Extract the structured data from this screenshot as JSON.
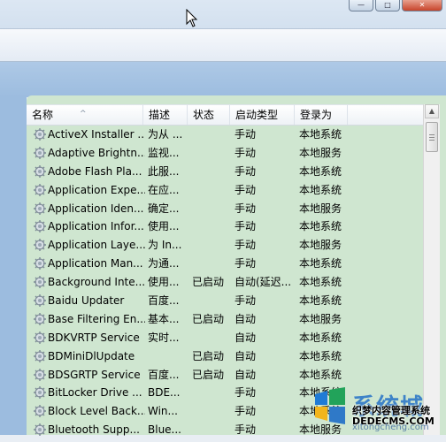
{
  "window": {
    "minimize_glyph": "—",
    "maximize_glyph": "□",
    "close_glyph": "✕"
  },
  "columns": {
    "name": "名称",
    "desc": "描述",
    "status": "状态",
    "startup": "启动类型",
    "logon": "登录为"
  },
  "rows": [
    {
      "name": "ActiveX Installer ...",
      "desc": "为从 ...",
      "status": "",
      "startup": "手动",
      "logon": "本地系统"
    },
    {
      "name": "Adaptive Brightn...",
      "desc": "监视...",
      "status": "",
      "startup": "手动",
      "logon": "本地服务"
    },
    {
      "name": "Adobe Flash Pla...",
      "desc": "此服...",
      "status": "",
      "startup": "手动",
      "logon": "本地系统"
    },
    {
      "name": "Application Expe...",
      "desc": "在应...",
      "status": "",
      "startup": "手动",
      "logon": "本地系统"
    },
    {
      "name": "Application Iden...",
      "desc": "确定...",
      "status": "",
      "startup": "手动",
      "logon": "本地服务"
    },
    {
      "name": "Application Infor...",
      "desc": "使用...",
      "status": "",
      "startup": "手动",
      "logon": "本地系统"
    },
    {
      "name": "Application Laye...",
      "desc": "为 In...",
      "status": "",
      "startup": "手动",
      "logon": "本地服务"
    },
    {
      "name": "Application Man...",
      "desc": "为通...",
      "status": "",
      "startup": "手动",
      "logon": "本地系统"
    },
    {
      "name": "Background Inte...",
      "desc": "使用...",
      "status": "已启动",
      "startup": "自动(延迟...",
      "logon": "本地系统"
    },
    {
      "name": "Baidu Updater",
      "desc": "百度...",
      "status": "",
      "startup": "手动",
      "logon": "本地系统"
    },
    {
      "name": "Base Filtering En...",
      "desc": "基本...",
      "status": "已启动",
      "startup": "自动",
      "logon": "本地服务"
    },
    {
      "name": "BDKVRTP Service",
      "desc": "实时...",
      "status": "",
      "startup": "自动",
      "logon": "本地系统"
    },
    {
      "name": "BDMiniDlUpdate",
      "desc": "",
      "status": "已启动",
      "startup": "自动",
      "logon": "本地系统"
    },
    {
      "name": "BDSGRTP Service",
      "desc": "百度...",
      "status": "已启动",
      "startup": "自动",
      "logon": "本地系统"
    },
    {
      "name": "BitLocker Drive ...",
      "desc": "BDE...",
      "status": "",
      "startup": "手动",
      "logon": "本地系统"
    },
    {
      "name": "Block Level Back...",
      "desc": "Win...",
      "status": "",
      "startup": "手动",
      "logon": "本地系统"
    },
    {
      "name": "Bluetooth Supp...",
      "desc": "Blue...",
      "status": "",
      "startup": "手动",
      "logon": "本地服务"
    }
  ],
  "watermark": {
    "title": "系统城",
    "line1": "织梦内容管理系统",
    "line2": "DEDECMS.COM",
    "line3": "xitongcheng.com"
  },
  "scrollbar": {
    "up_glyph": "▲"
  },
  "colors": {
    "list_background": "#cfe6d0",
    "chrome_blue": "#9cbcdf",
    "watermark_blue": "#2f79c8"
  },
  "icons": {
    "service": "gear-icon",
    "cursor": "mouse-cursor-icon",
    "watermark": "system-city-logo-icon"
  }
}
